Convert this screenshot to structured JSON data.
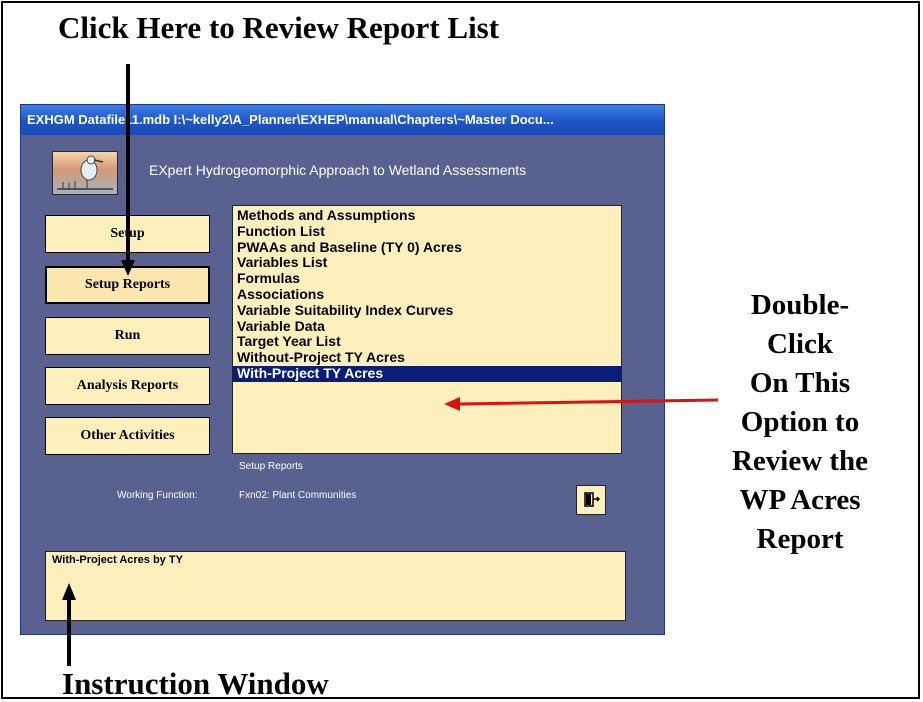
{
  "annotations": {
    "top": "Click Here to Review Report List",
    "right_lines": [
      "Double-",
      "Click",
      "On This",
      "Option to",
      "Review the",
      "WP Acres",
      "Report"
    ],
    "bottom": "Instruction Window"
  },
  "window": {
    "title": "EXHGM    Datafile11.mdb    I:\\~kelly2\\A_Planner\\EXHEP\\manual\\Chapters\\~Master Docu...",
    "app_title": "EXpert Hydrogeomorphic Approach to Wetland Assessments"
  },
  "nav": {
    "setup": "Setup",
    "setup_reports": "Setup Reports",
    "run": "Run",
    "analysis_reports": "Analysis Reports",
    "other_activities": "Other Activities"
  },
  "report_list": {
    "items": [
      "Methods and Assumptions",
      "Function List",
      "PWAAs and Baseline (TY 0) Acres",
      "Variables List",
      "Formulas",
      "Associations",
      "Variable Suitability Index Curves",
      "Variable Data",
      "Target Year List",
      "Without-Project TY Acres",
      "With-Project TY Acres"
    ],
    "selected_index": 10
  },
  "status": {
    "section": "Setup Reports",
    "working_function_label": "Working Function:",
    "working_function_value": "Fxn02: Plant Communities"
  },
  "instruction_text": "With-Project Acres by TY",
  "colors": {
    "window_bg": "#58618f",
    "button_bg": "#fdf0bc",
    "selection_bg": "#0a1d78",
    "arrow_red": "#e01010"
  }
}
